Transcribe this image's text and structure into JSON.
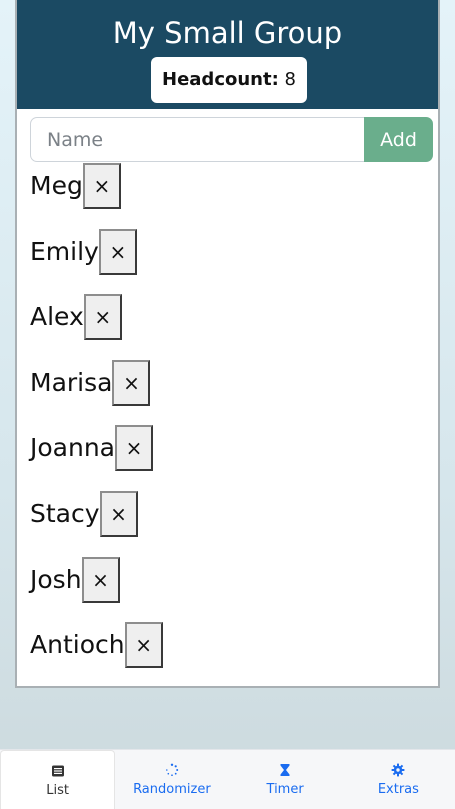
{
  "header": {
    "title": "My Small Group",
    "headcount_label": "Headcount:",
    "headcount_value": "8"
  },
  "add_form": {
    "placeholder": "Name",
    "button_label": "Add"
  },
  "members": [
    {
      "name": "Meg",
      "remove": "×"
    },
    {
      "name": "Emily",
      "remove": "×"
    },
    {
      "name": "Alex",
      "remove": "×"
    },
    {
      "name": "Marisa",
      "remove": "×"
    },
    {
      "name": "Joanna",
      "remove": "×"
    },
    {
      "name": "Stacy",
      "remove": "×"
    },
    {
      "name": "Josh",
      "remove": "×"
    },
    {
      "name": "Antioch",
      "remove": "×"
    }
  ],
  "tabs": [
    {
      "label": "List",
      "icon": "list-icon",
      "active": true
    },
    {
      "label": "Randomizer",
      "icon": "spinner-icon",
      "active": false
    },
    {
      "label": "Timer",
      "icon": "hourglass-icon",
      "active": false
    },
    {
      "label": "Extras",
      "icon": "gear-icon",
      "active": false
    }
  ],
  "colors": {
    "header_bg": "#1b4a63",
    "add_button": "#6aae8c",
    "tab_accent": "#1a6cf0"
  }
}
